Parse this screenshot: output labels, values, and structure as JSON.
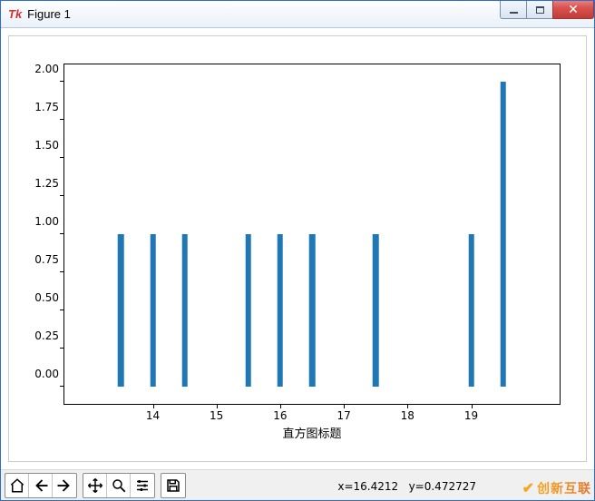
{
  "window": {
    "title": "Figure 1"
  },
  "chart_data": {
    "type": "bar",
    "title": "",
    "xlabel": "直方图标题",
    "ylabel": "",
    "xlim": [
      13,
      20
    ],
    "ylim": [
      0.0,
      2.0
    ],
    "xticks": [
      14,
      15,
      16,
      17,
      18,
      19
    ],
    "yticks": [
      0.0,
      0.25,
      0.5,
      0.75,
      1.0,
      1.25,
      1.5,
      1.75,
      2.0
    ],
    "ytick_labels": [
      "0.00",
      "0.25",
      "0.50",
      "0.75",
      "1.00",
      "1.25",
      "1.50",
      "1.75",
      "2.00"
    ],
    "bars": [
      {
        "x": 13.5,
        "y": 1.0
      },
      {
        "x": 14.0,
        "y": 1.0
      },
      {
        "x": 14.5,
        "y": 1.0
      },
      {
        "x": 15.5,
        "y": 1.0
      },
      {
        "x": 16.0,
        "y": 1.0
      },
      {
        "x": 16.5,
        "y": 1.0
      },
      {
        "x": 17.5,
        "y": 1.0
      },
      {
        "x": 19.0,
        "y": 1.0
      },
      {
        "x": 19.5,
        "y": 2.0
      }
    ]
  },
  "toolbar": {
    "home": "Home",
    "back": "Back",
    "forward": "Forward",
    "pan": "Pan",
    "zoom": "Zoom",
    "configure": "Configure",
    "save": "Save"
  },
  "status": {
    "coord_x_label": "x=16.4212",
    "coord_y_label": "y=0.472727"
  },
  "watermark": "创新互联"
}
